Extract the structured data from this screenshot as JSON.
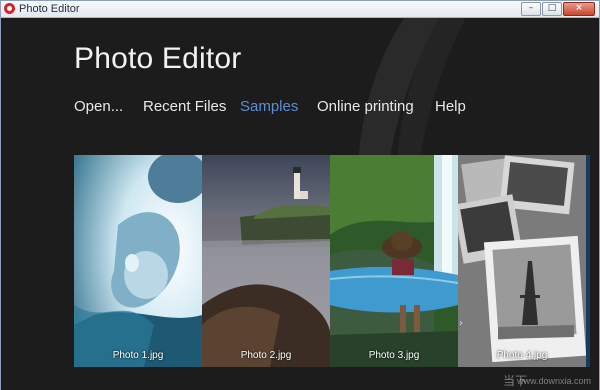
{
  "window": {
    "title": "Photo Editor",
    "controls": {
      "minimize": "–",
      "maximize": "□",
      "close": "×"
    }
  },
  "app": {
    "title": "Photo Editor"
  },
  "nav": {
    "items": [
      {
        "label": "Open..."
      },
      {
        "label": "Recent Files"
      },
      {
        "label": "Samples",
        "active": true
      },
      {
        "label": "Online printing"
      },
      {
        "label": "Help"
      }
    ]
  },
  "samples": [
    {
      "caption": "Photo 1.jpg"
    },
    {
      "caption": "Photo 2.jpg"
    },
    {
      "caption": "Photo 3.jpg"
    },
    {
      "caption": "Photo 4.jpg"
    }
  ],
  "watermark": {
    "logo": "当下",
    "text": "www.downxia.com"
  },
  "colors": {
    "background": "#1c1c1d",
    "accent": "#5b8fd4",
    "text": "#e8e8e8",
    "close": "#c8452f"
  }
}
